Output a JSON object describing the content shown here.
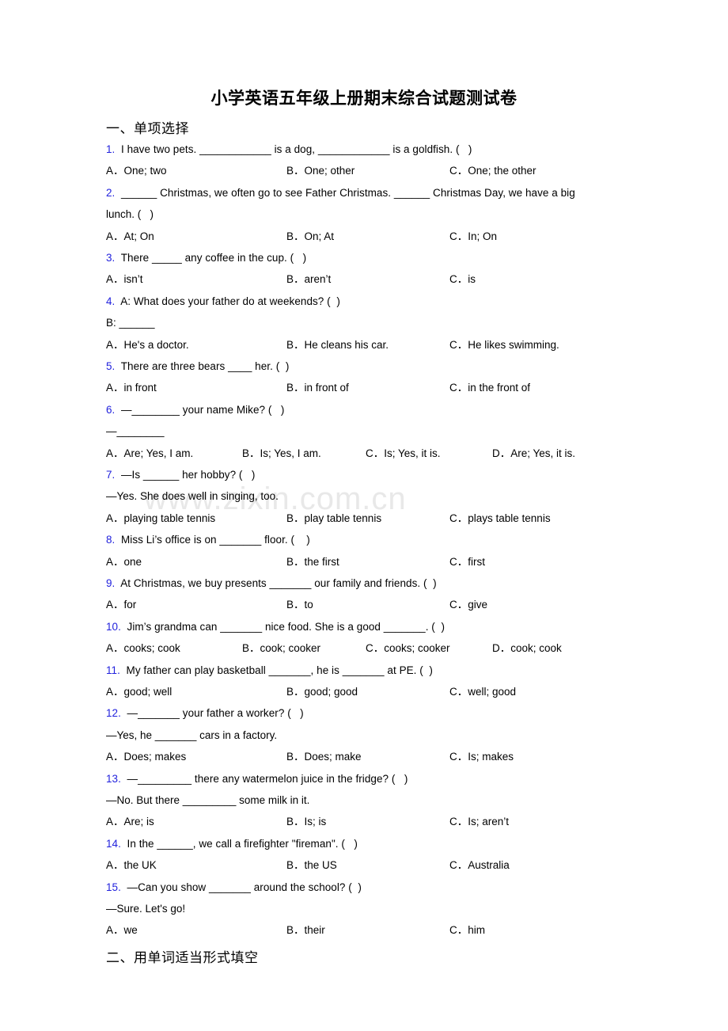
{
  "document": {
    "title": "小学英语五年级上册期末综合试题测试卷",
    "watermark": "www.zixin.com.cn"
  },
  "sections": [
    {
      "heading": "一、单项选择"
    },
    {
      "heading": "二、用单词适当形式填空"
    }
  ],
  "questions": [
    {
      "num": "1.",
      "text": "I have two pets. ____________ is a dog, ____________ is a goldfish. (   )",
      "cont": null,
      "cols": 3,
      "options": [
        "A．One; two",
        "B．One; other",
        "C．One; the other"
      ]
    },
    {
      "num": "2.",
      "text": "______ Christmas, we often go to see Father Christmas. ______ Christmas Day, we have a big",
      "cont": "lunch. (   )",
      "cols": 3,
      "options": [
        "A．At; On",
        "B．On; At",
        "C．In; On"
      ]
    },
    {
      "num": "3.",
      "text": "There _____ any coffee in the cup. (   )",
      "cont": null,
      "cols": 3,
      "options": [
        "A．isn’t",
        "B．aren’t",
        "C．is"
      ]
    },
    {
      "num": "4.",
      "text": "A: What does your father do at weekends? (  )",
      "cont": "B: ______",
      "cols": 3,
      "options": [
        "A．He's a doctor.",
        "B．He cleans his car.",
        "C．He likes swimming."
      ]
    },
    {
      "num": "5.",
      "text": "There are three bears ____ her. (  )",
      "cont": null,
      "cols": 3,
      "options": [
        "A．in front",
        "B．in front of",
        "C．in the front of"
      ]
    },
    {
      "num": "6.",
      "text": "—________ your name Mike? (   )",
      "cont": "—________",
      "cols": 4,
      "options": [
        "A．Are; Yes, I am.",
        "B．Is; Yes, I am.",
        "C．Is; Yes, it is.",
        "D．Are; Yes, it is."
      ]
    },
    {
      "num": "7.",
      "text": "—Is ______ her hobby? (   )",
      "cont": "—Yes. She does well in singing, too.",
      "cols": 3,
      "options": [
        "A．playing table tennis",
        "B．play table tennis",
        "C．plays table tennis"
      ]
    },
    {
      "num": "8.",
      "text": "Miss Li’s office is on _______ floor. (    )",
      "cont": null,
      "cols": 3,
      "options": [
        "A．one",
        "B．the first",
        "C．first"
      ]
    },
    {
      "num": "9.",
      "text": "At Christmas, we buy presents _______ our family and friends. (  )",
      "cont": null,
      "cols": 3,
      "options": [
        "A．for",
        "B．to",
        "C．give"
      ]
    },
    {
      "num": "10.",
      "text": "Jim’s grandma can _______ nice food. She is a good _______. (  )",
      "cont": null,
      "cols": 4,
      "options": [
        "A．cooks; cook",
        "B．cook; cooker",
        "C．cooks; cooker",
        "D．cook; cook"
      ]
    },
    {
      "num": "11.",
      "text": "My father can play basketball _______, he is _______ at PE. (  )",
      "cont": null,
      "cols": 3,
      "options": [
        "A．good; well",
        "B．good; good",
        "C．well; good"
      ]
    },
    {
      "num": "12.",
      "text": "—_______ your father a worker? (   )",
      "cont": "—Yes, he _______ cars in a factory.",
      "cols": 3,
      "options": [
        "A．Does; makes",
        "B．Does; make",
        "C．Is; makes"
      ]
    },
    {
      "num": "13.",
      "text": "—_________ there any watermelon juice in the fridge? (   )",
      "cont": "—No. But there _________ some milk in it.",
      "cols": 3,
      "options": [
        "A．Are; is",
        "B．Is; is",
        "C．Is; aren’t"
      ]
    },
    {
      "num": "14.",
      "text": "In the ______, we call a firefighter \"fireman\". (   )",
      "cont": null,
      "cols": 3,
      "options": [
        "A．the UK",
        "B．the US",
        "C．Australia"
      ]
    },
    {
      "num": "15.",
      "text": "—Can you show _______ around the school? (  )",
      "cont": "—Sure. Let's go!",
      "cols": 3,
      "options": [
        "A．we",
        "B．their",
        "C．him"
      ]
    }
  ]
}
